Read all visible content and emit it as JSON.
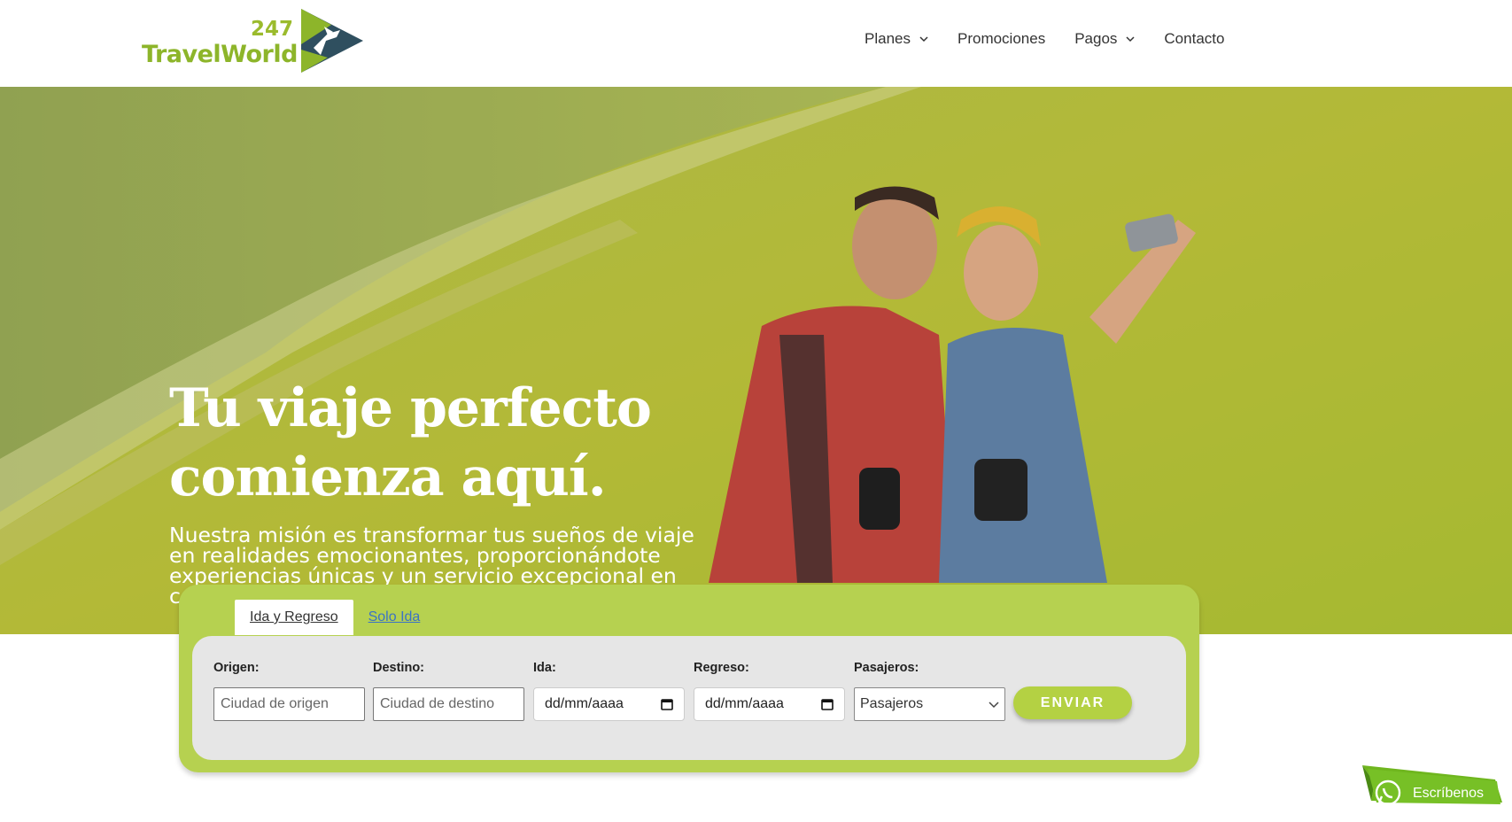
{
  "brand": {
    "logo_number": "247",
    "logo_word": "TravelWorld",
    "colors": {
      "green": "#9bbb2d",
      "dark": "#2f4f5f"
    }
  },
  "nav": {
    "items": [
      {
        "label": "Planes",
        "has_dropdown": true
      },
      {
        "label": "Promociones",
        "has_dropdown": false
      },
      {
        "label": "Pagos",
        "has_dropdown": true
      },
      {
        "label": "Contacto",
        "has_dropdown": false
      }
    ]
  },
  "hero": {
    "title": "Tu viaje perfecto comienza aquí.",
    "subtitle": "Nuestra misión es transformar tus sueños de viaje en realidades emocionantes, proporcionándote experiencias únicas y un servicio excepcional en cada paso del camino."
  },
  "booking": {
    "tabs": [
      {
        "label": "Ida y Regreso",
        "active": true
      },
      {
        "label": "Solo Ida",
        "active": false
      }
    ],
    "fields": {
      "origin": {
        "label": "Origen:",
        "placeholder": "Ciudad de origen"
      },
      "destination": {
        "label": "Destino:",
        "placeholder": "Ciudad de destino"
      },
      "departure": {
        "label": "Ida:",
        "value": "dd/mm/aaaa"
      },
      "return": {
        "label": "Regreso:",
        "value": "dd/mm/aaaa"
      },
      "passengers": {
        "label": "Pasajeros:",
        "selected": "Pasajeros"
      }
    },
    "submit_label": "ENVIAR"
  },
  "whatsapp": {
    "label": "Escríbenos",
    "icon": "whatsapp-icon"
  }
}
